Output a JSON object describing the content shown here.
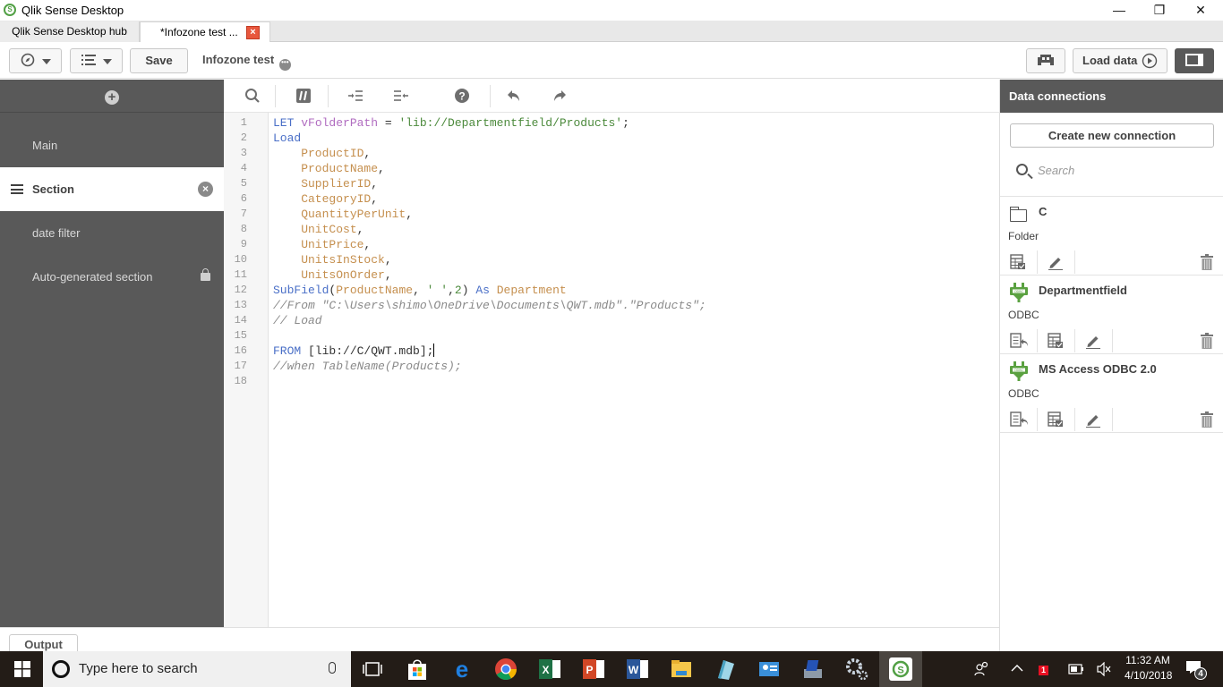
{
  "window": {
    "title": "Qlik Sense Desktop",
    "controls": [
      "minimize",
      "restore",
      "close"
    ]
  },
  "tabs": [
    {
      "label": "Qlik Sense Desktop hub",
      "active": false
    },
    {
      "label": "*Infozone test ...",
      "active": true,
      "close_icon": "close-icon"
    }
  ],
  "toolbar": {
    "nav_icon": "compass-icon",
    "list_icon": "list-icon",
    "save_label": "Save",
    "app_name": "Infozone test",
    "app_menu_icon": "more-icon",
    "debug_icon": "debug-icon",
    "load_data_label": "Load data",
    "panel_toggle_icon": "panel-toggle-icon"
  },
  "sidebar": {
    "add_icon": "plus-icon",
    "sections": [
      {
        "label": "Main",
        "active": false
      },
      {
        "label": "Section",
        "active": true
      },
      {
        "label": "date filter",
        "active": false
      },
      {
        "label": "Auto-generated section",
        "active": false,
        "locked": true
      }
    ]
  },
  "editor_toolbar": {
    "icons": [
      "search-icon",
      "comment-icon",
      "indent-icon",
      "outdent-icon",
      "help-icon",
      "undo-icon",
      "redo-icon"
    ]
  },
  "editor": {
    "line_numbers": [
      "1",
      "2",
      "3",
      "4",
      "5",
      "6",
      "7",
      "8",
      "9",
      "10",
      "11",
      "12",
      "13",
      "14",
      "15",
      "16",
      "17",
      "18"
    ],
    "lines": [
      [
        {
          "t": "LET ",
          "c": "kw"
        },
        {
          "t": "vFolderPath",
          "c": "var"
        },
        {
          "t": " = ",
          "c": ""
        },
        {
          "t": "'lib://Departmentfield/Products'",
          "c": "str"
        },
        {
          "t": ";",
          "c": ""
        }
      ],
      [
        {
          "t": "Load",
          "c": "kw"
        }
      ],
      [
        {
          "t": "    ProductID",
          "c": "fld"
        },
        {
          "t": ",",
          "c": ""
        }
      ],
      [
        {
          "t": "    ProductName",
          "c": "fld"
        },
        {
          "t": ",",
          "c": ""
        }
      ],
      [
        {
          "t": "    SupplierID",
          "c": "fld"
        },
        {
          "t": ",",
          "c": ""
        }
      ],
      [
        {
          "t": "    CategoryID",
          "c": "fld"
        },
        {
          "t": ",",
          "c": ""
        }
      ],
      [
        {
          "t": "    QuantityPerUnit",
          "c": "fld"
        },
        {
          "t": ",",
          "c": ""
        }
      ],
      [
        {
          "t": "    UnitCost",
          "c": "fld"
        },
        {
          "t": ",",
          "c": ""
        }
      ],
      [
        {
          "t": "    UnitPrice",
          "c": "fld"
        },
        {
          "t": ",",
          "c": ""
        }
      ],
      [
        {
          "t": "    UnitsInStock",
          "c": "fld"
        },
        {
          "t": ",",
          "c": ""
        }
      ],
      [
        {
          "t": "    UnitsOnOrder",
          "c": "fld"
        },
        {
          "t": ",",
          "c": ""
        }
      ],
      [
        {
          "t": "SubField",
          "c": "kw"
        },
        {
          "t": "(",
          "c": ""
        },
        {
          "t": "ProductName",
          "c": "fld"
        },
        {
          "t": ", ",
          "c": ""
        },
        {
          "t": "' '",
          "c": "str"
        },
        {
          "t": ",",
          "c": ""
        },
        {
          "t": "2",
          "c": "num"
        },
        {
          "t": ") ",
          "c": ""
        },
        {
          "t": "As ",
          "c": "kw"
        },
        {
          "t": "Department",
          "c": "fld"
        }
      ],
      [
        {
          "t": "//From \"C:\\Users\\shimo\\OneDrive\\Documents\\QWT.mdb\".\"Products\";",
          "c": "cmt"
        }
      ],
      [
        {
          "t": "// Load",
          "c": "cmt"
        }
      ],
      [],
      [
        {
          "t": "FROM ",
          "c": "kw"
        },
        {
          "t": "[lib://C/QWT.mdb];",
          "c": ""
        }
      ],
      [
        {
          "t": "//when TableName(Products);",
          "c": "cmt"
        }
      ],
      []
    ],
    "cursor_line": 16
  },
  "output": {
    "tab_label": "Output"
  },
  "data_connections": {
    "title": "Data connections",
    "create_label": "Create new connection",
    "search_placeholder": "Search",
    "items": [
      {
        "name": "C",
        "type": "Folder",
        "icon": "folder-icon",
        "actions": [
          "select-data-icon",
          "edit-icon",
          "delete-icon"
        ]
      },
      {
        "name": "Departmentfield",
        "type": "ODBC",
        "icon": "odbc-plug-icon",
        "actions": [
          "insert-connect-icon",
          "select-data-icon",
          "edit-icon",
          "delete-icon"
        ]
      },
      {
        "name": "MS Access ODBC 2.0",
        "type": "ODBC",
        "icon": "odbc-plug-icon",
        "actions": [
          "insert-connect-icon",
          "select-data-icon",
          "edit-icon",
          "delete-icon"
        ]
      }
    ]
  },
  "taskbar": {
    "search_placeholder": "Type here to search",
    "apps": [
      "task-view-icon",
      "store-icon",
      "edge-icon",
      "chrome-icon",
      "excel-icon",
      "powerpoint-icon",
      "word-icon",
      "file-explorer-icon",
      "notepad-icon",
      "control-panel-icon",
      "network-icon",
      "settings-icon",
      "qlik-sense-icon"
    ],
    "time": "11:32 AM",
    "date": "4/10/2018",
    "notification_count": "4",
    "badge_count": "1"
  },
  "colors": {
    "sidebar_bg": "#595959",
    "keyword": "#4a6fc7",
    "variable": "#b06cc0",
    "string": "#4c8a3c",
    "field": "#c58f4e",
    "comment": "#8a8a8a",
    "odbc_green": "#5aa140"
  }
}
